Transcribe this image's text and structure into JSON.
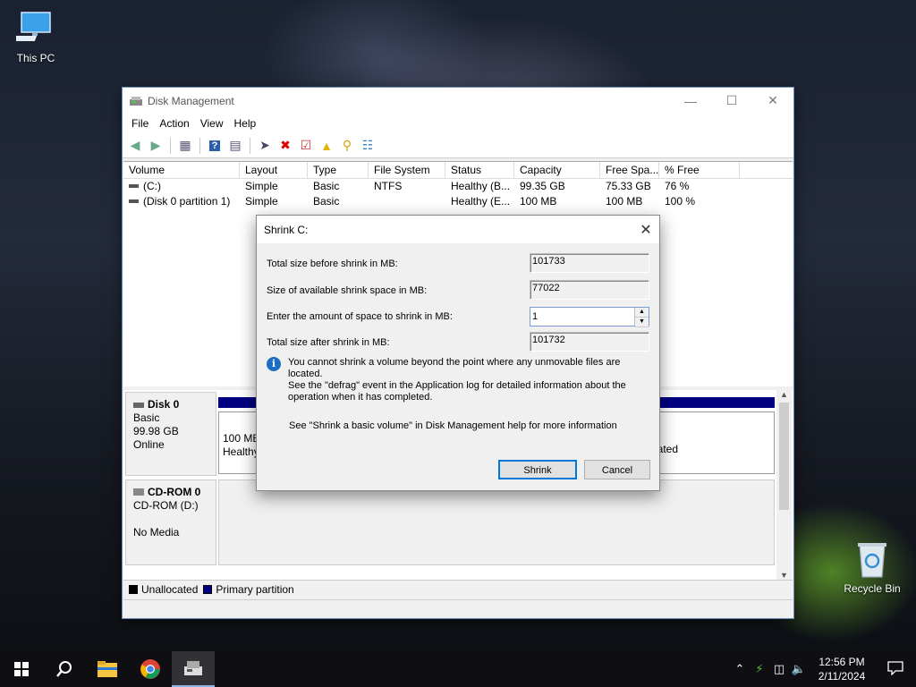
{
  "desktop": {
    "this_pc_label": "This PC",
    "recycle_bin_label": "Recycle Bin"
  },
  "window": {
    "title": "Disk Management",
    "menu": [
      "File",
      "Action",
      "View",
      "Help"
    ],
    "toolbar_icons": [
      "back-arrow-icon",
      "forward-arrow-icon",
      "properties-icon",
      "help-icon",
      "list-view-icon",
      "connect-icon",
      "delete-icon",
      "check-icon",
      "folder-up-icon",
      "search-folder-icon",
      "settings-list-icon"
    ],
    "columns": [
      "Volume",
      "Layout",
      "Type",
      "File System",
      "Status",
      "Capacity",
      "Free Spa...",
      "% Free"
    ],
    "rows": [
      [
        "(C:)",
        "Simple",
        "Basic",
        "NTFS",
        "Healthy (B...",
        "99.35 GB",
        "75.33 GB",
        "76 %"
      ],
      [
        "(Disk 0 partition 1)",
        "Simple",
        "Basic",
        "",
        "Healthy (E...",
        "100 MB",
        "100 MB",
        "100 %"
      ]
    ],
    "disks": {
      "disk0": {
        "name": "Disk 0",
        "type": "Basic",
        "size": "99.98 GB",
        "status": "Online",
        "part1_size": "100 MB",
        "part1_status": "Healthy",
        "part2_status_tail": "ated"
      },
      "cdrom0": {
        "name": "CD-ROM 0",
        "drive": "CD-ROM (D:)",
        "media": "No Media"
      }
    },
    "legend": {
      "unallocated": "Unallocated",
      "primary": "Primary partition",
      "unallocated_color": "#000000",
      "primary_color": "#000080"
    }
  },
  "dialog": {
    "title": "Shrink C:",
    "total_before_label": "Total size before shrink in MB:",
    "total_before_value": "101733",
    "available_label": "Size of available shrink space in MB:",
    "available_value": "77022",
    "enter_label": "Enter the amount of space to shrink in MB:",
    "enter_value": "1",
    "total_after_label": "Total size after shrink in MB:",
    "total_after_value": "101732",
    "info_text_1": "You cannot shrink a volume beyond the point where any unmovable files are located.",
    "info_text_2": "See the \"defrag\" event in the Application log for detailed information about the",
    "info_text_3": "operation when it has completed.",
    "help_text": "See \"Shrink a basic volume\" in Disk Management help for more information",
    "shrink_button": "Shrink",
    "cancel_button": "Cancel"
  },
  "taskbar": {
    "time": "12:56 PM",
    "date": "2/11/2024"
  }
}
